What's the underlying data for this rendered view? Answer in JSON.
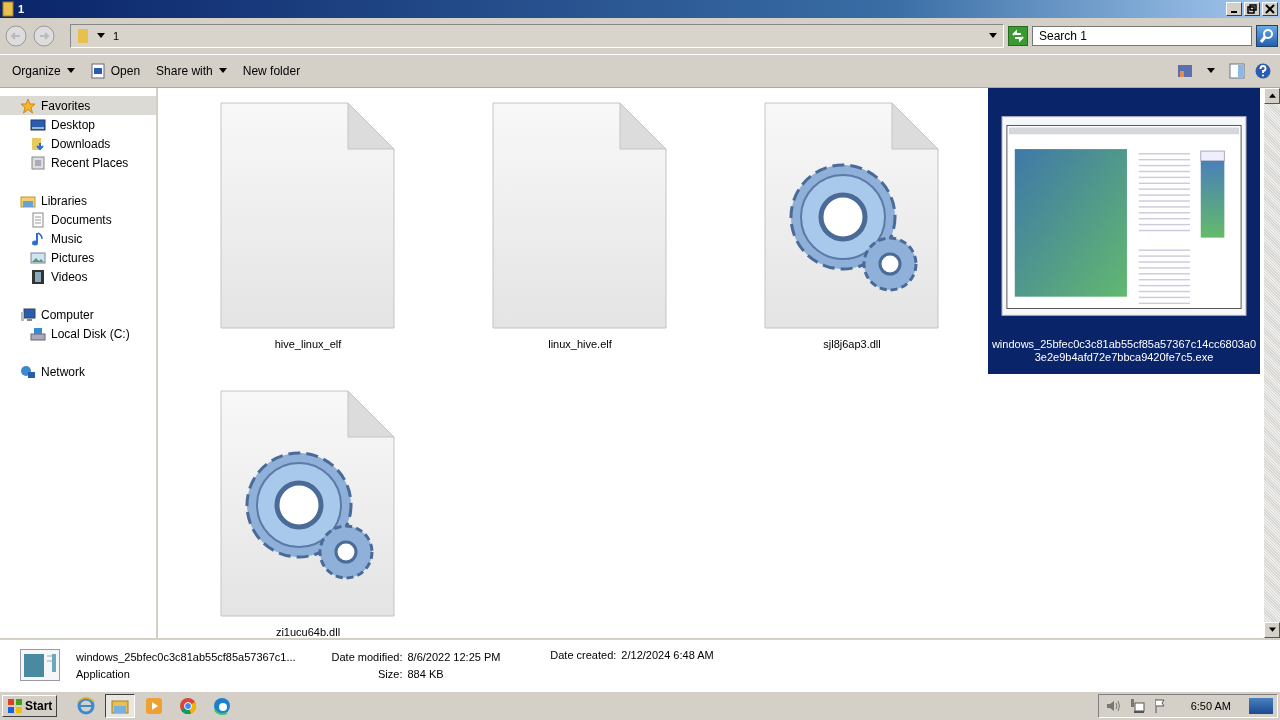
{
  "window": {
    "title": "1"
  },
  "address_bar": {
    "path": "1",
    "search_placeholder": "Search 1"
  },
  "toolbar": {
    "items": [
      {
        "label": "Organize",
        "kind": "menu"
      },
      {
        "label": "Open",
        "kind": "open"
      },
      {
        "label": "Share with",
        "kind": "menu"
      },
      {
        "label": "New folder",
        "kind": "plain"
      }
    ]
  },
  "sidebar": {
    "groups": [
      {
        "label": "Favorites",
        "selected": true,
        "children": [
          {
            "label": "Desktop",
            "selected": false
          },
          {
            "label": "Downloads",
            "selected": false
          },
          {
            "label": "Recent Places",
            "selected": false
          }
        ]
      },
      {
        "label": "Libraries",
        "selected": false,
        "children": [
          {
            "label": "Documents",
            "selected": false
          },
          {
            "label": "Music",
            "selected": false
          },
          {
            "label": "Pictures",
            "selected": false
          },
          {
            "label": "Videos",
            "selected": false
          }
        ]
      },
      {
        "label": "Computer",
        "selected": false,
        "children": [
          {
            "label": "Local Disk (C:)",
            "selected": false
          }
        ]
      },
      {
        "label": "Network",
        "selected": false
      }
    ]
  },
  "files": [
    {
      "name": "hive_linux_elf",
      "kind": "blank",
      "selected": false
    },
    {
      "name": "linux_hive.elf",
      "kind": "blank",
      "selected": false
    },
    {
      "name": "sjl8j6ap3.dll",
      "kind": "gears",
      "selected": false
    },
    {
      "name": "windows_25bfec0c3c81ab55cf85a57367c14cc6803a03e2e9b4afd72e7bbca9420fe7c5.exe",
      "kind": "app",
      "selected": true
    },
    {
      "name": "zi1ucu64b.dll",
      "kind": "gears",
      "selected": false
    }
  ],
  "details": {
    "name": "windows_25bfec0c3c81ab55cf85a57367c1...",
    "type": "Application",
    "modified_label": "Date modified:",
    "modified": "8/6/2022 12:25 PM",
    "size_label": "Size:",
    "size": "884 KB",
    "created_label": "Date created:",
    "created": "2/12/2024 6:48 AM"
  },
  "taskbar": {
    "start": "Start",
    "apps": [
      {
        "kind": "ie",
        "selected": false
      },
      {
        "kind": "explorer",
        "selected": true
      },
      {
        "kind": "media",
        "selected": false
      },
      {
        "kind": "chrome",
        "selected": false
      },
      {
        "kind": "edge",
        "selected": false
      }
    ],
    "clock": "6:50 AM"
  }
}
